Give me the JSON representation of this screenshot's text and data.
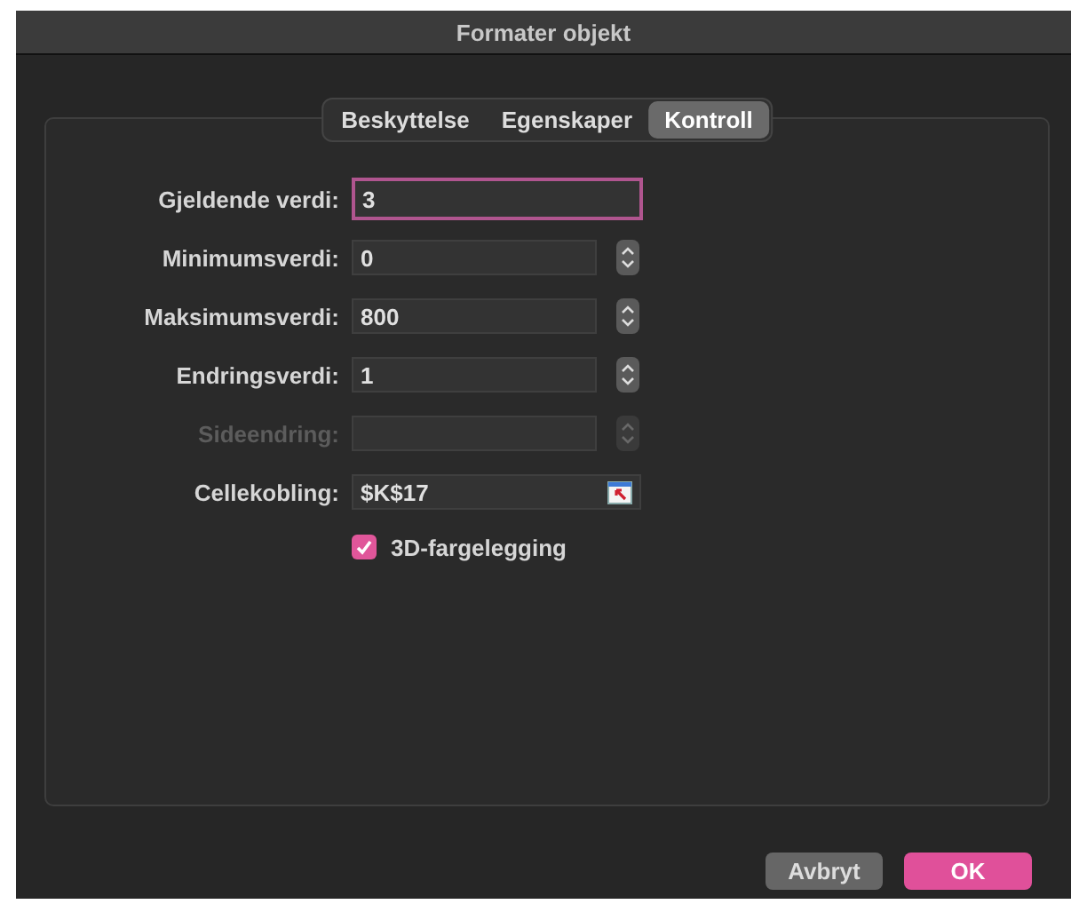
{
  "window": {
    "title": "Formater objekt"
  },
  "tabs": [
    {
      "label": "Beskyttelse",
      "selected": false
    },
    {
      "label": "Egenskaper",
      "selected": false
    },
    {
      "label": "Kontroll",
      "selected": true
    }
  ],
  "fields": [
    {
      "kind": "text",
      "label": "Gjeldende verdi:",
      "value": "3",
      "focused": true,
      "disabled": false
    },
    {
      "kind": "stepper",
      "label": "Minimumsverdi:",
      "value": "0",
      "focused": false,
      "disabled": false
    },
    {
      "kind": "stepper",
      "label": "Maksimumsverdi:",
      "value": "800",
      "focused": false,
      "disabled": false
    },
    {
      "kind": "stepper",
      "label": "Endringsverdi:",
      "value": "1",
      "focused": false,
      "disabled": false
    },
    {
      "kind": "stepper",
      "label": "Sideendring:",
      "focused": false,
      "disabled": true
    },
    {
      "kind": "link",
      "label": "Cellekobling:",
      "value": "$K$17",
      "focused": false,
      "disabled": false
    }
  ],
  "checkbox": {
    "label": "3D-fargelegging",
    "checked": true
  },
  "buttons": [
    {
      "label": "Avbryt",
      "kind": "secondary"
    },
    {
      "label": "OK",
      "kind": "primary"
    }
  ]
}
